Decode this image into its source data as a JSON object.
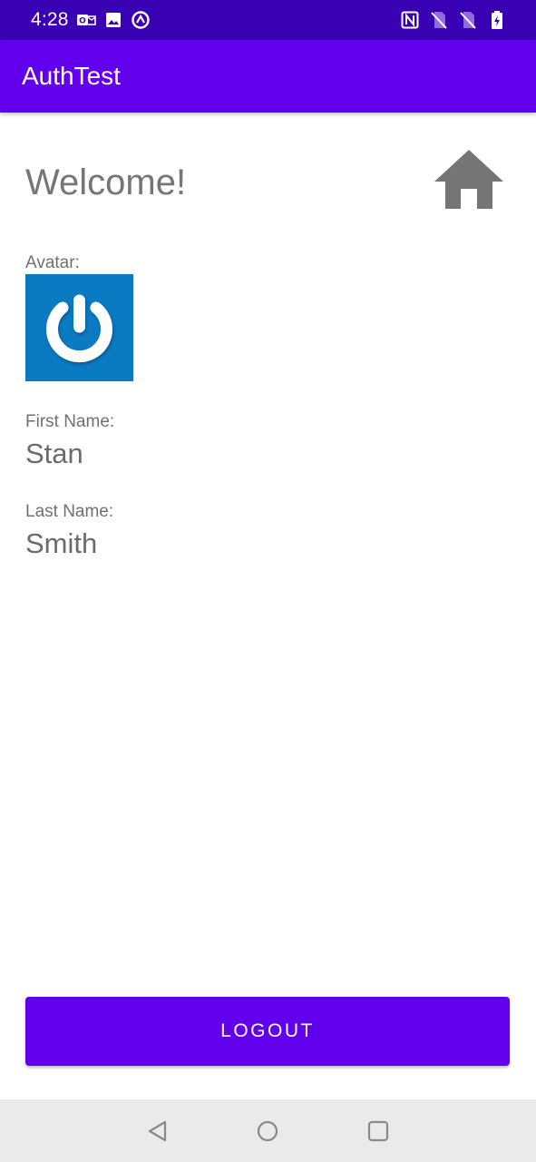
{
  "status_bar": {
    "time": "4:28",
    "left_icons": [
      "outlook-icon",
      "image-icon",
      "vpn-icon"
    ],
    "right_icons": [
      "nfc-icon",
      "sim-off-icon",
      "sim-off-icon",
      "battery-charging-icon"
    ]
  },
  "app_bar": {
    "title": "AuthTest",
    "color": "#6200ee"
  },
  "main": {
    "welcome": "Welcome!",
    "home_icon": "home-icon",
    "avatar_label": "Avatar:",
    "avatar_icon": "power-icon",
    "first_name_label": "First Name:",
    "first_name": "Stan",
    "last_name_label": "Last Name:",
    "last_name": "Smith"
  },
  "logout_label": "LOGOUT",
  "nav_bar": {
    "buttons": [
      "back-icon",
      "home-circle-icon",
      "recents-icon"
    ]
  },
  "colors": {
    "status_bar": "#3a00b3",
    "accent": "#6200ee",
    "avatar_bg": "#0a7ac2",
    "nav_bar": "#eaeaea"
  }
}
